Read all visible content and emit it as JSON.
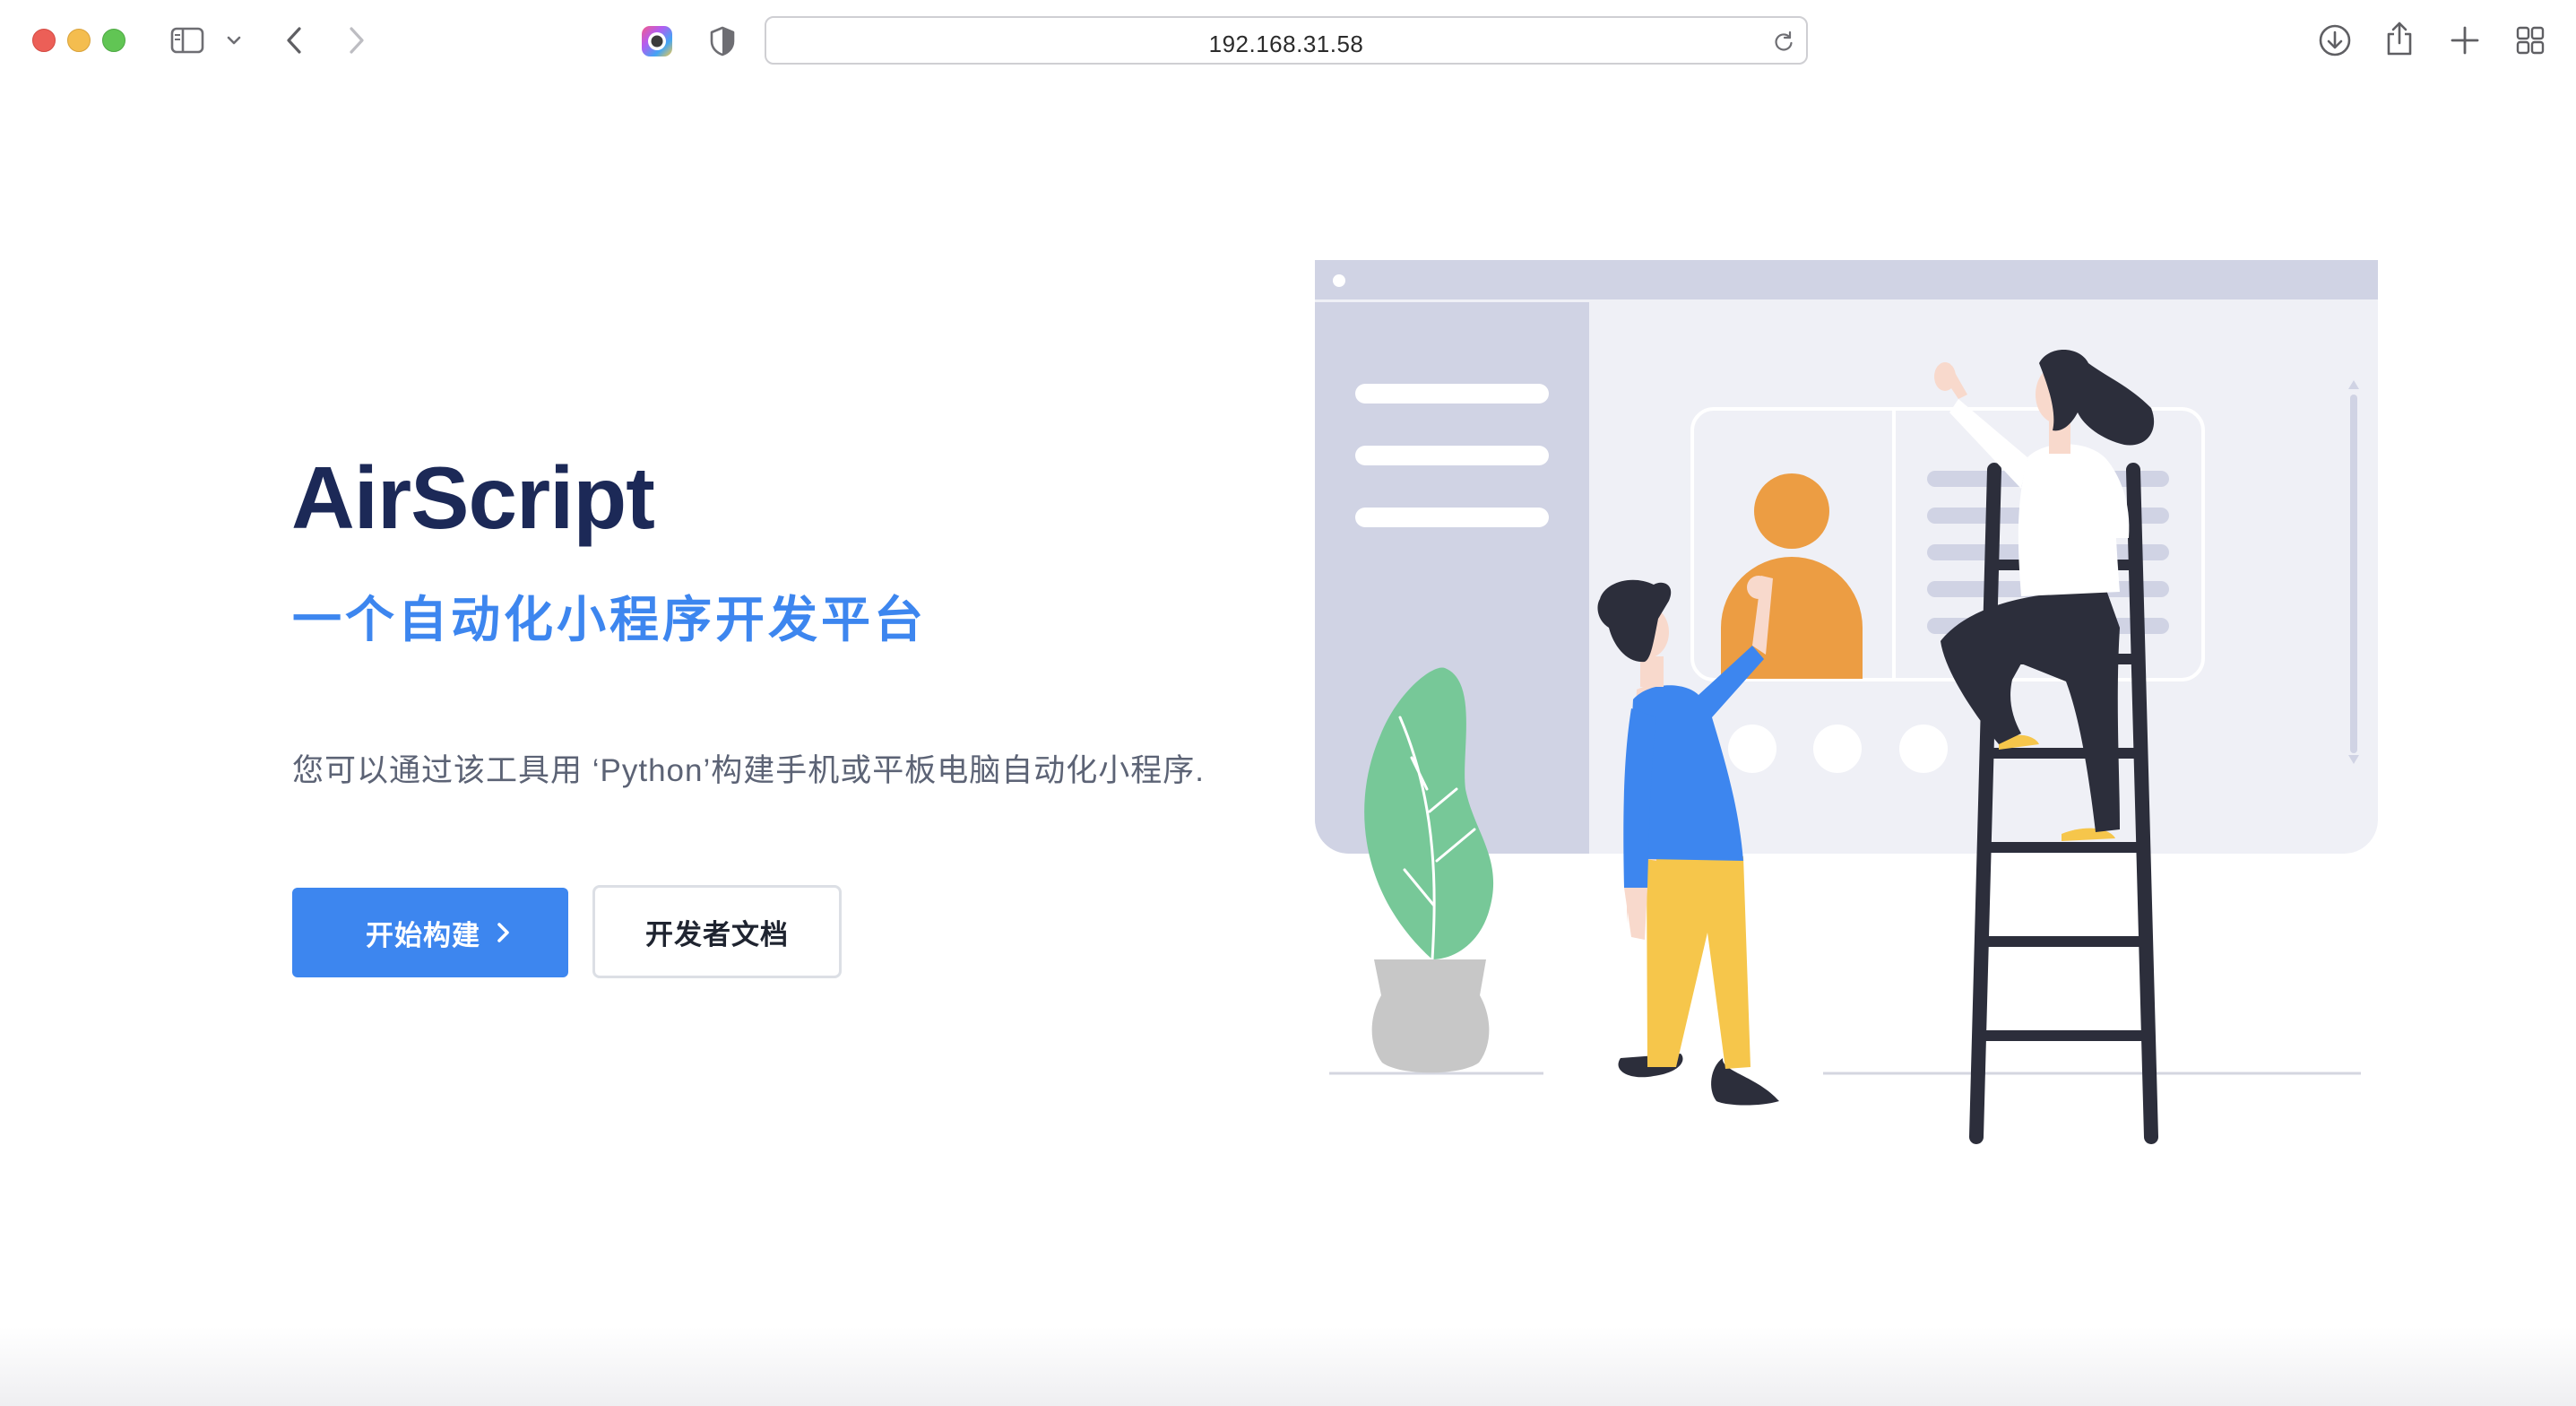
{
  "browser": {
    "address": "192.168.31.58",
    "icons": [
      "sidebar-icon",
      "chevron-down-icon",
      "back-icon",
      "forward-icon",
      "extension-icon",
      "shield-icon",
      "reload-icon",
      "download-icon",
      "share-icon",
      "new-tab-icon",
      "tab-overview-icon"
    ]
  },
  "hero": {
    "title": "AirScript",
    "subtitle": "一个自动化小程序开发平台",
    "description": "您可以通过该工具用 ‘Python’构建手机或平板电脑自动化小程序.",
    "primary_button": "开始构建",
    "secondary_button": "开发者文档"
  },
  "colors": {
    "brand_blue": "#3d86ef",
    "title_navy": "#1c2957",
    "text_gray": "#5c6375",
    "illustration_panel": "#d0d3e4",
    "illustration_orange": "#ec9d43"
  }
}
